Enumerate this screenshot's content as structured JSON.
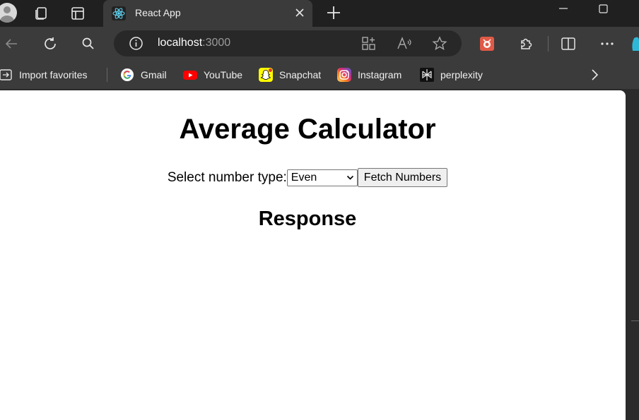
{
  "tab": {
    "title": "React App"
  },
  "address": {
    "host": "localhost",
    "port": ":3000"
  },
  "favorites": [
    {
      "label": "Import favorites",
      "icon": "import-icon"
    },
    {
      "label": "Gmail",
      "icon": "google-icon"
    },
    {
      "label": "YouTube",
      "icon": "youtube-icon"
    },
    {
      "label": "Snapchat",
      "icon": "snapchat-icon"
    },
    {
      "label": "Instagram",
      "icon": "instagram-icon"
    },
    {
      "label": "perplexity",
      "icon": "perplexity-icon"
    }
  ],
  "page": {
    "title": "Average Calculator",
    "select_label": "Select number type:",
    "select_value": "Even",
    "fetch_button": "Fetch Numbers",
    "response_heading": "Response"
  },
  "colors": {
    "tabbar_bg": "#202020",
    "toolbar_bg": "#3b3b3b",
    "page_bg": "#ffffff",
    "react_blue": "#61dafb"
  }
}
